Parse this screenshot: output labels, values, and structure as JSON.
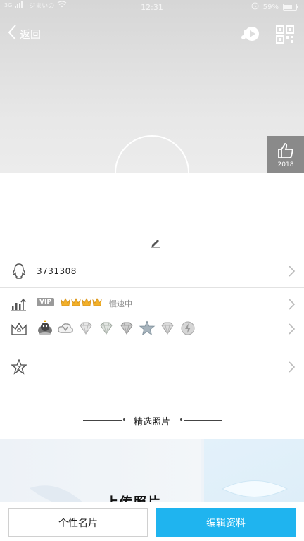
{
  "status_bar": {
    "network": "3G",
    "carrier": "ジまいの",
    "time": "12:31",
    "battery": "59%",
    "battery_level": 0.59
  },
  "nav": {
    "back_label": "返回",
    "icons": [
      "music-play-icon",
      "qr-code-icon"
    ]
  },
  "like": {
    "count": "2018",
    "icon": "thumbs-up-icon"
  },
  "profile": {
    "qq_number": "3731308",
    "vip_tag": "VIP",
    "vip_crowns": 4,
    "vip_speed": "慢速中",
    "badge_icons": [
      "qq-penguin-badge",
      "cloud-v-badge",
      "diamond-badge",
      "diamond-badge",
      "diamond-badge",
      "star-badge",
      "diamond-badge",
      "lightning-badge"
    ]
  },
  "photos": {
    "section_title": "精选照片",
    "caption": "上传照片"
  },
  "bottom": {
    "card_button": "个性名片",
    "edit_button": "编辑资料"
  },
  "colors": {
    "accent": "#1fb4ef",
    "header_gray": "#dcdcdc",
    "like_box": "#8a8a8a"
  }
}
